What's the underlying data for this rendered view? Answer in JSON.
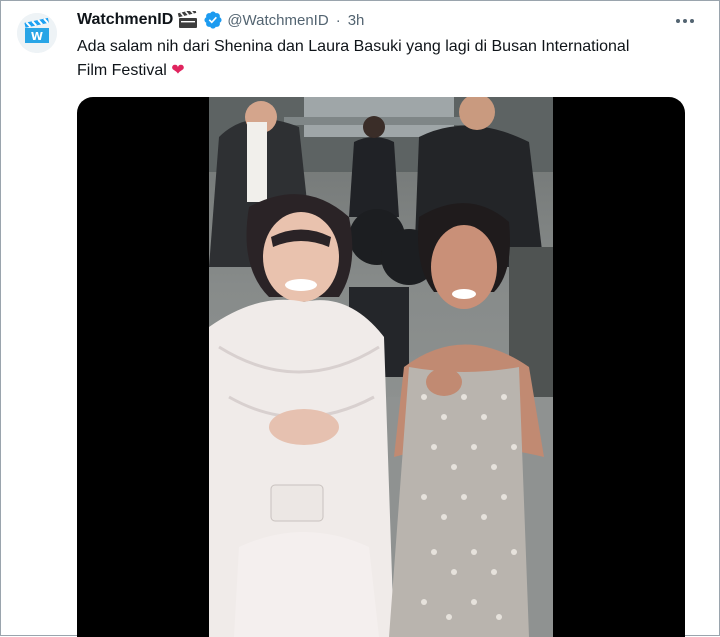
{
  "tweet": {
    "display_name": "WatchmenID",
    "name_emoji": "clapper-board",
    "verified": true,
    "handle": "@WatchmenID",
    "separator": "·",
    "time": "3h",
    "text": "Ada salam nih dari Shenina dan Laura Basuki yang lagi di Busan International Film Festival",
    "text_emoji": "❤",
    "avatar_letter": "W"
  },
  "colors": {
    "link_blue": "#1d9bf0",
    "secondary_text": "#536471",
    "heart": "#e0245e"
  },
  "media": {
    "type": "video",
    "description_icon": "video-frame"
  }
}
